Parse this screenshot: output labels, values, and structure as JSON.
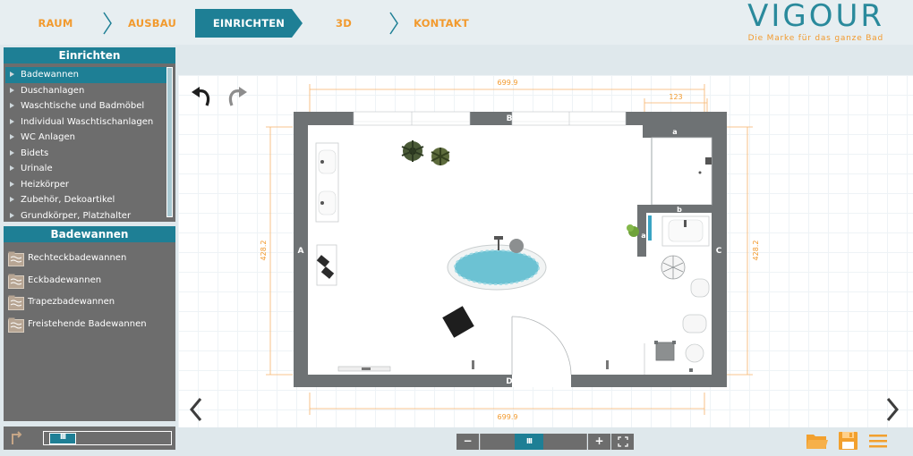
{
  "nav": {
    "steps": [
      {
        "label": "RAUM",
        "active": false
      },
      {
        "label": "AUSBAU",
        "active": false
      },
      {
        "label": "EINRICHTEN",
        "active": true
      },
      {
        "label": "3D",
        "active": false
      },
      {
        "label": "KONTAKT",
        "active": false
      }
    ]
  },
  "logo": {
    "brand": "VIGOUR",
    "tagline": "Die Marke für das ganze Bad"
  },
  "left_panel": {
    "category_header": "Einrichten",
    "categories": [
      "Badewannen",
      "Duschanlagen",
      "Waschtische und Badmöbel",
      "Individual Waschtischanlagen",
      "WC Anlagen",
      "Bidets",
      "Urinale",
      "Heizkörper",
      "Zubehör, Dekoartikel",
      "Grundkörper, Platzhalter"
    ],
    "selected_category": "Badewannen",
    "sub_header": "Badewannen",
    "subcategories": [
      "Rechteckbadewannen",
      "Eckbadewannen",
      "Trapezbadewannen",
      "Freistehende Badewannen"
    ]
  },
  "plan": {
    "dim_top": "699.9",
    "dim_bottom": "699.9",
    "dim_left": "428.2",
    "dim_right": "428.2",
    "dim_corner": "123",
    "wall_labels": {
      "top": "B",
      "left": "A",
      "right": "C",
      "bottom": "D"
    },
    "item_labels": {
      "a_top": "a",
      "a_side": "a",
      "b": "b"
    }
  },
  "icons": {
    "undo": "undo-icon",
    "redo": "redo-icon",
    "prev": "chevron-left-icon",
    "next": "chevron-right-icon",
    "folder": "folder-icon",
    "save": "save-icon",
    "menu": "menu-icon",
    "fullscreen": "fullscreen-icon",
    "up": "up-arrow-icon"
  },
  "zoom": {
    "minus": "−",
    "plus": "+",
    "thumb": "III"
  },
  "colors": {
    "accent": "#1e7f95",
    "orange": "#f29a2e",
    "panel": "#6d6d6d",
    "wall": "#6e7274"
  }
}
